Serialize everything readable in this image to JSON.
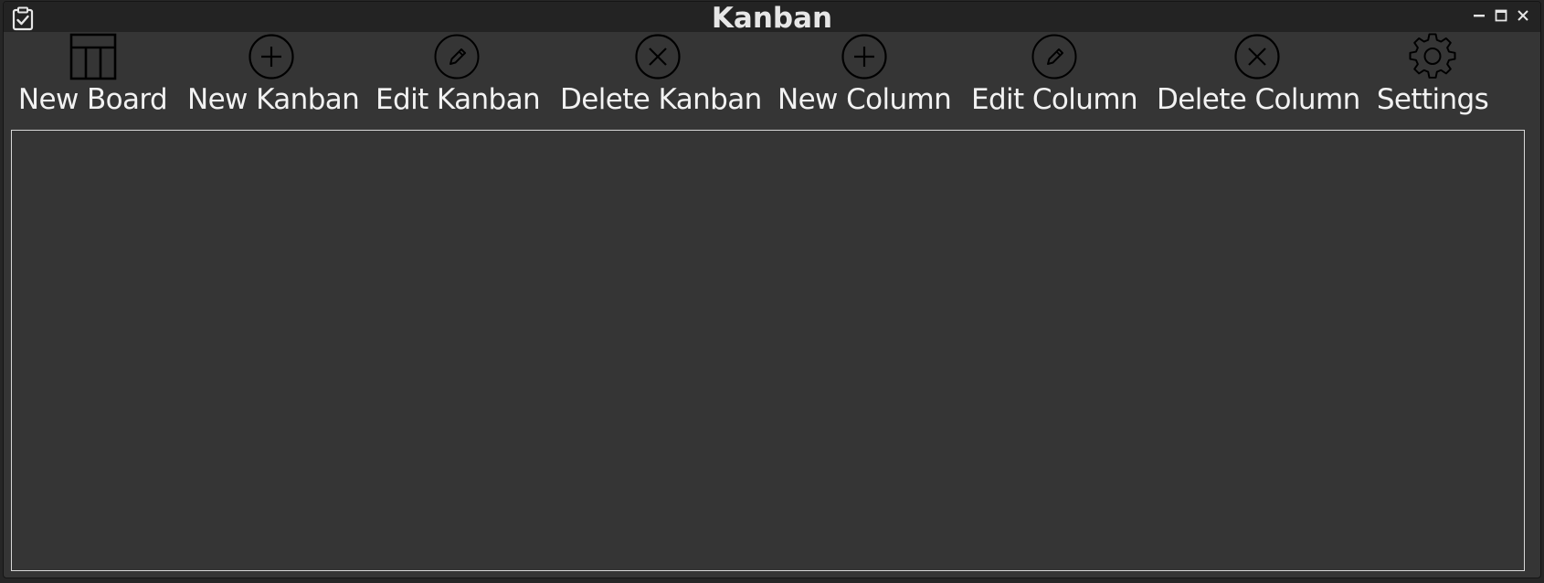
{
  "window": {
    "title": "Kanban",
    "app_icon": "clipboard-check-icon",
    "controls": [
      "minimize-icon",
      "maximize-icon",
      "close-icon"
    ]
  },
  "toolbar": {
    "items": [
      {
        "label": "New Board",
        "icon": "table-layout-icon"
      },
      {
        "label": "New Kanban",
        "icon": "circle-plus-icon"
      },
      {
        "label": "Edit Kanban",
        "icon": "circle-pencil-icon"
      },
      {
        "label": "Delete Kanban",
        "icon": "circle-x-icon"
      },
      {
        "label": "New Column",
        "icon": "circle-plus-icon"
      },
      {
        "label": "Edit Column",
        "icon": "circle-pencil-icon"
      },
      {
        "label": "Delete Column",
        "icon": "circle-x-icon"
      },
      {
        "label": "Settings",
        "icon": "gear-icon"
      }
    ]
  },
  "colors": {
    "window_bg": "#353535",
    "titlebar_bg": "#232323",
    "text": "#f2f2f2",
    "icon_stroke": "#000000",
    "board_border": "#d8d8d8"
  }
}
